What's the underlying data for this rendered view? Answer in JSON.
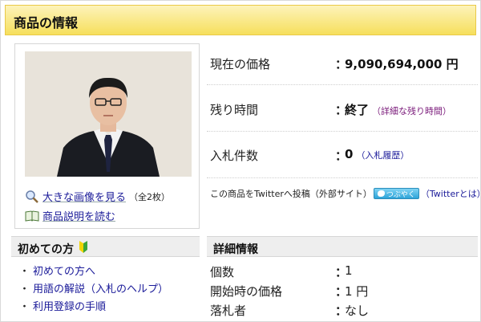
{
  "header": {
    "title": "商品の情報"
  },
  "photo_panel": {
    "enlarge_link": "大きな画像を見る",
    "enlarge_note": "（全2枚）",
    "description_link": "商品説明を読む"
  },
  "price_rows": [
    {
      "label": "現在の価格",
      "value": "9,090,694,000 円",
      "sub": ""
    },
    {
      "label": "残り時間",
      "value": "終了",
      "sub": "（詳細な残り時間）"
    },
    {
      "label": "入札件数",
      "value": "0",
      "sub": "（入札履歴）"
    }
  ],
  "twitter": {
    "text": "この商品をTwitterへ投稿（外部サイト）",
    "button": "つぶやく",
    "link": "（Twitterとは）"
  },
  "beginner": {
    "title": "初めての方",
    "items": [
      "初めての方へ",
      "用語の解説（入札のヘルプ）",
      "利用登録の手順"
    ]
  },
  "details": {
    "title": "詳細情報",
    "rows": [
      {
        "label": "個数",
        "value": "1"
      },
      {
        "label": "開始時の価格",
        "value": "1 円"
      },
      {
        "label": "落札者",
        "value": "なし"
      }
    ]
  },
  "colors": {
    "header_bg": "#f6df5c",
    "link": "#1a1a99",
    "accent_link": "#7a1a7a"
  }
}
